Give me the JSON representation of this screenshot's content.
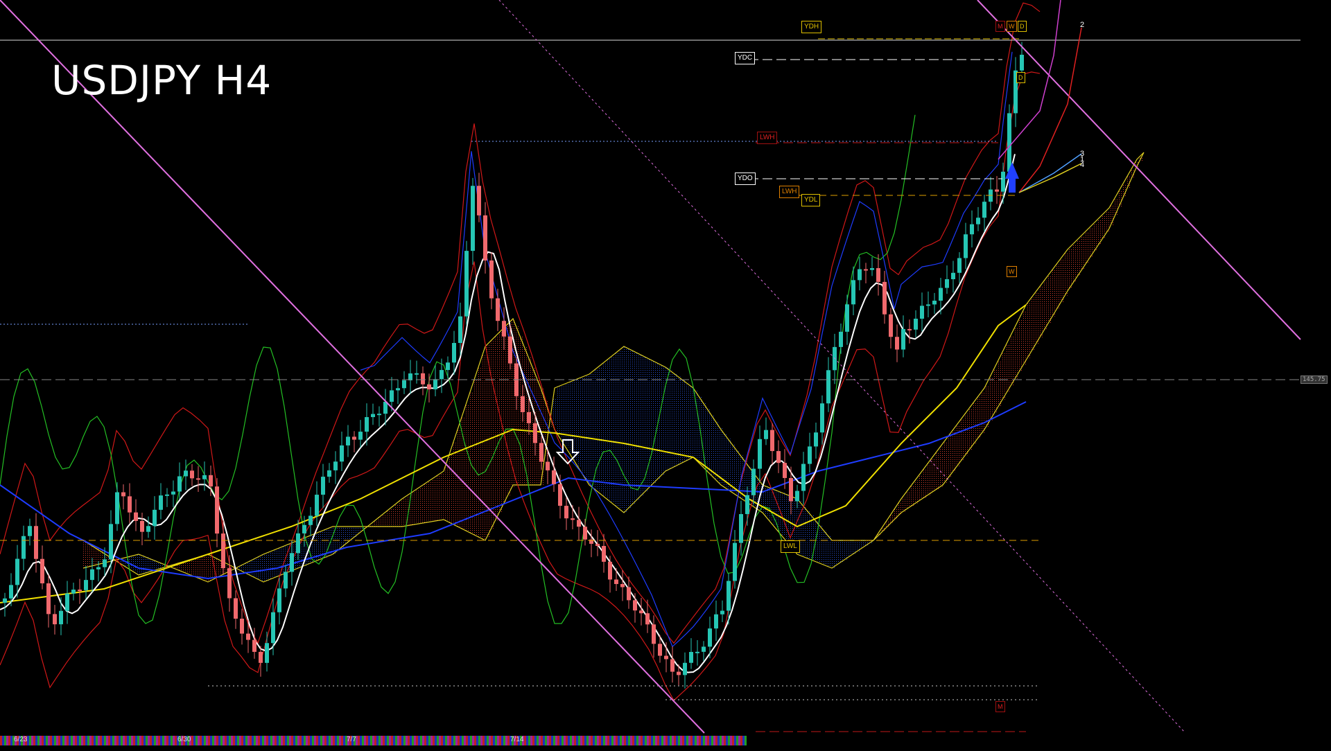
{
  "header": {
    "title": "USDJPY H4"
  },
  "price_readout": "145.75",
  "levels": {
    "ydh": "YDH",
    "ydc": "YDC",
    "lwh": "LWH",
    "ydo": "YDO",
    "lwh2": "LWH",
    "ydl": "YDL",
    "lwl": "LWL",
    "m1": "M",
    "w1": "W",
    "d1": "D",
    "d2": "D",
    "w2": "W",
    "m2": "M"
  },
  "fan_labels": [
    "2",
    "3",
    "1",
    "4"
  ],
  "x_axis_labels": [
    "6/23",
    "6/30",
    "7/7",
    "7/14"
  ],
  "colors": {
    "background": "#000000",
    "bull": "#26c6b4",
    "bear": "#f0696d",
    "cloud_bull": "#1e3aa0",
    "cloud_bear": "#c0302a",
    "trendline": "#e070e0",
    "ma_white": "#ffffff",
    "ma_yellow": "#f0e000",
    "ma_blue": "#1e3cff",
    "rsi_green": "#24c024",
    "bollinger": "#d01818",
    "envelope": "#e0d020"
  },
  "chart_data": {
    "type": "candlestick",
    "title": "USDJPY H4",
    "timeframe": "H4",
    "x_tick_labels": [
      "6/23",
      "6/30",
      "7/7",
      "7/14"
    ],
    "overlays": [
      "Ichimoku cloud",
      "Bollinger bands",
      "Moving averages",
      "Trend channel lines"
    ],
    "grid": false
  }
}
